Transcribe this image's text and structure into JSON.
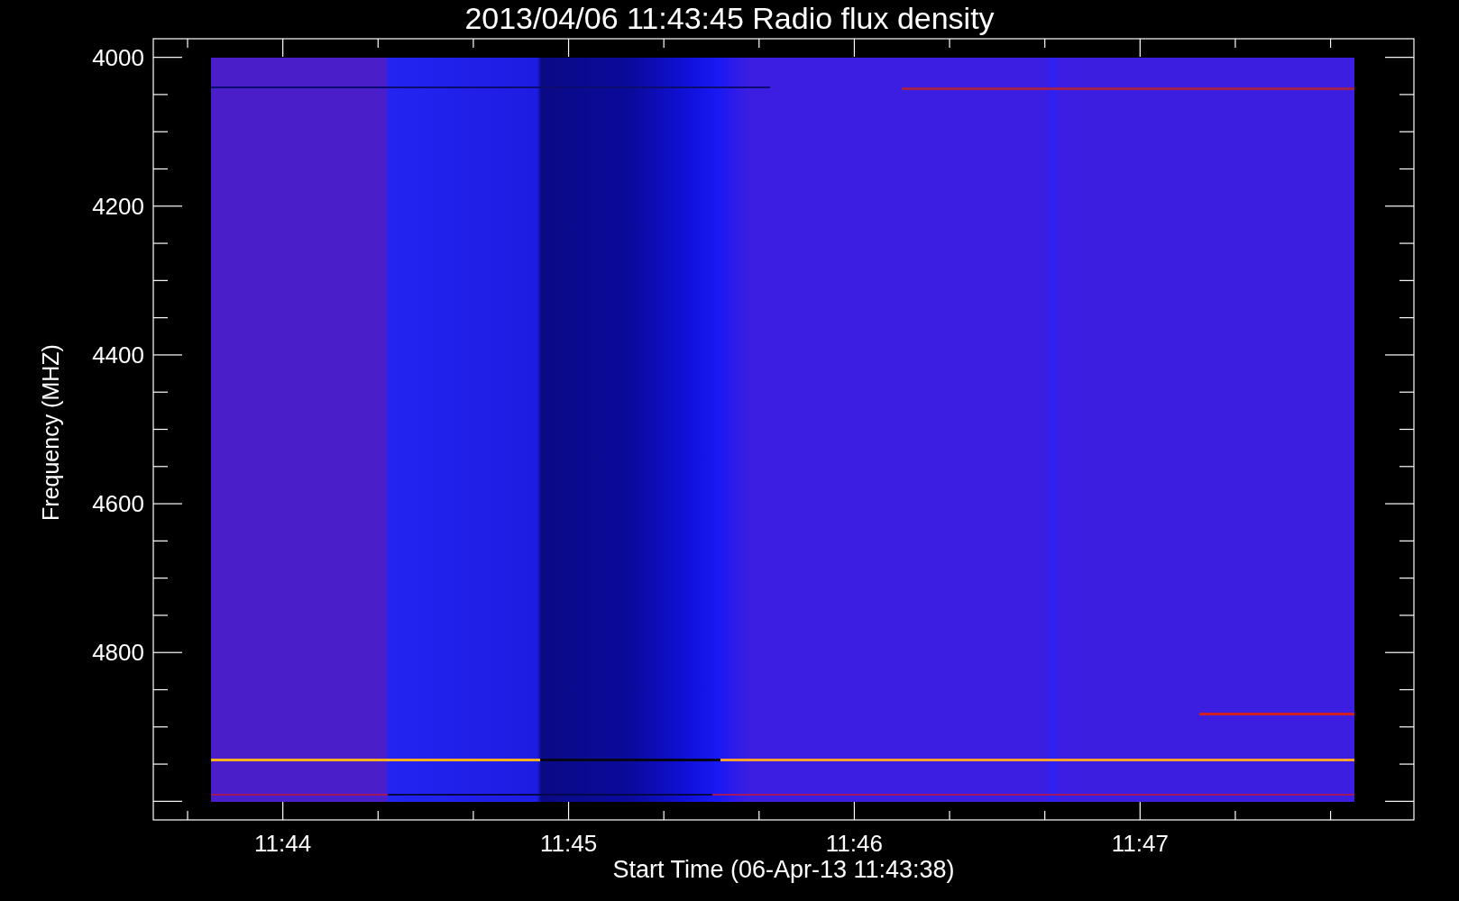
{
  "title": "2013/04/06 11:43:45 Radio flux density",
  "y_axis": {
    "label": "Frequency (MHZ)",
    "ticks": [
      "4000",
      "4200",
      "4400",
      "4600",
      "4800"
    ]
  },
  "x_axis": {
    "label": "Start Time (06-Apr-13 11:43:38)",
    "ticks": [
      "11:44",
      "11:45",
      "11:46",
      "11:47"
    ]
  }
}
